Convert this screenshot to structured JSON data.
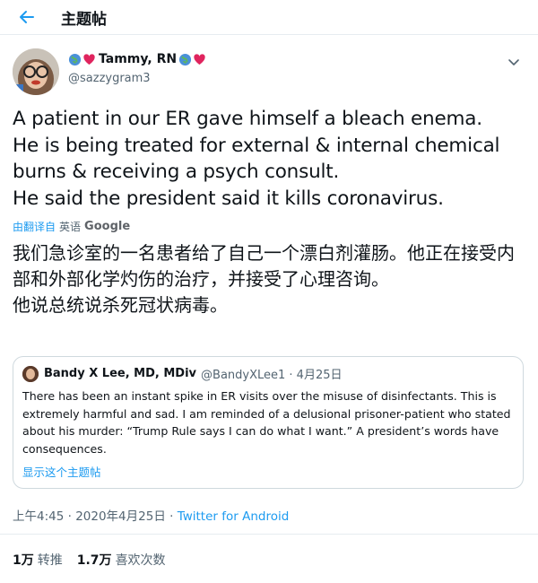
{
  "header": {
    "title": "主题帖"
  },
  "author": {
    "name": "Tammy, RN",
    "handle": "@sazzygram3"
  },
  "tweet": {
    "text": "A patient in our ER gave himself a bleach enema.\nHe is being treated for external & internal chemical burns & receiving a psych consult.\nHe said the president said it kills coronavirus."
  },
  "translate": {
    "label": "由翻译自",
    "language": "英语",
    "provider": "Google"
  },
  "translation": {
    "text": "我们急诊室的一名患者给了自己一个漂白剂灌肠。他正在接受内部和外部化学灼伤的治疗，并接受了心理咨询。\n他说总统说杀死冠状病毒。"
  },
  "quote": {
    "name": "Bandy X Lee, MD, MDiv",
    "handle": "@BandyXLee1 · 4月25日",
    "text": "There has been an instant spike in ER visits over the misuse of disinfectants. This is extremely harmful and sad.  I am reminded of a delusional prisoner-patient who stated about his murder: “Trump Rule says I can do what I want.”  A president’s words have consequences.",
    "show_thread": "显示这个主题帖"
  },
  "meta": {
    "time": "上午4:45 · 2020年4月25日 · ",
    "source": "Twitter for Android"
  },
  "stats": {
    "retweets_count": "1万",
    "retweets_label": "转推",
    "likes_count": "1.7万",
    "likes_label": "喜欢次数"
  },
  "colors": {
    "accent": "#1d9bf0",
    "secondary_text": "#536471",
    "heart": "#e0245e"
  },
  "icons": [
    "back-arrow-icon",
    "globe-icon",
    "heart-icon",
    "chevron-down-icon"
  ]
}
